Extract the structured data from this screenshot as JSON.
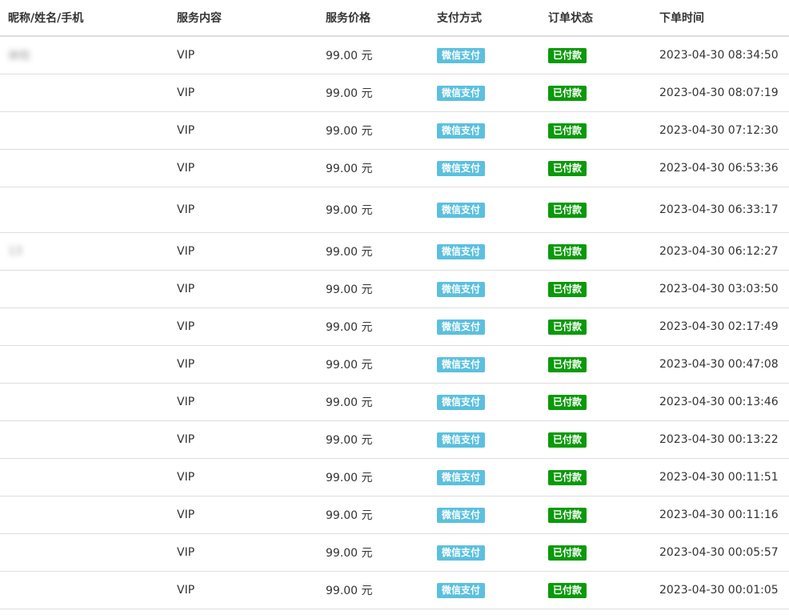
{
  "table": {
    "headers": {
      "name": "昵称/姓名/手机",
      "service": "服务内容",
      "price": "服务价格",
      "payment": "支付方式",
      "status": "订单状态",
      "time": "下单时间"
    },
    "rows": [
      {
        "name": "体检",
        "service": "VIP",
        "price": "99.00 元",
        "payment": "微信支付",
        "status": "已付款",
        "time": "2023-04-30 08:34:50"
      },
      {
        "name": "",
        "service": "VIP",
        "price": "99.00 元",
        "payment": "微信支付",
        "status": "已付款",
        "time": "2023-04-30 08:07:19"
      },
      {
        "name": "",
        "service": "VIP",
        "price": "99.00 元",
        "payment": "微信支付",
        "status": "已付款",
        "time": "2023-04-30 07:12:30"
      },
      {
        "name": "",
        "service": "VIP",
        "price": "99.00 元",
        "payment": "微信支付",
        "status": "已付款",
        "time": "2023-04-30 06:53:36"
      },
      {
        "name": "",
        "service": "VIP",
        "price": "99.00 元",
        "payment": "微信支付",
        "status": "已付款",
        "time": "2023-04-30 06:33:17"
      },
      {
        "name": "13",
        "service": "VIP",
        "price": "99.00 元",
        "payment": "微信支付",
        "status": "已付款",
        "time": "2023-04-30 06:12:27"
      },
      {
        "name": "",
        "service": "VIP",
        "price": "99.00 元",
        "payment": "微信支付",
        "status": "已付款",
        "time": "2023-04-30 03:03:50"
      },
      {
        "name": "",
        "service": "VIP",
        "price": "99.00 元",
        "payment": "微信支付",
        "status": "已付款",
        "time": "2023-04-30 02:17:49"
      },
      {
        "name": "",
        "service": "VIP",
        "price": "99.00 元",
        "payment": "微信支付",
        "status": "已付款",
        "time": "2023-04-30 00:47:08"
      },
      {
        "name": "",
        "service": "VIP",
        "price": "99.00 元",
        "payment": "微信支付",
        "status": "已付款",
        "time": "2023-04-30 00:13:46"
      },
      {
        "name": "",
        "service": "VIP",
        "price": "99.00 元",
        "payment": "微信支付",
        "status": "已付款",
        "time": "2023-04-30 00:13:22"
      },
      {
        "name": "",
        "service": "VIP",
        "price": "99.00 元",
        "payment": "微信支付",
        "status": "已付款",
        "time": "2023-04-30 00:11:51"
      },
      {
        "name": "",
        "service": "VIP",
        "price": "99.00 元",
        "payment": "微信支付",
        "status": "已付款",
        "time": "2023-04-30 00:11:16"
      },
      {
        "name": "",
        "service": "VIP",
        "price": "99.00 元",
        "payment": "微信支付",
        "status": "已付款",
        "time": "2023-04-30 00:05:57"
      },
      {
        "name": "",
        "service": "VIP",
        "price": "99.00 元",
        "payment": "微信支付",
        "status": "已付款",
        "time": "2023-04-30 00:01:05"
      }
    ]
  },
  "colors": {
    "wechat_badge": "#5bc0de",
    "paid_badge": "#0a9a0a",
    "border": "#dddddd",
    "text": "#333333"
  }
}
